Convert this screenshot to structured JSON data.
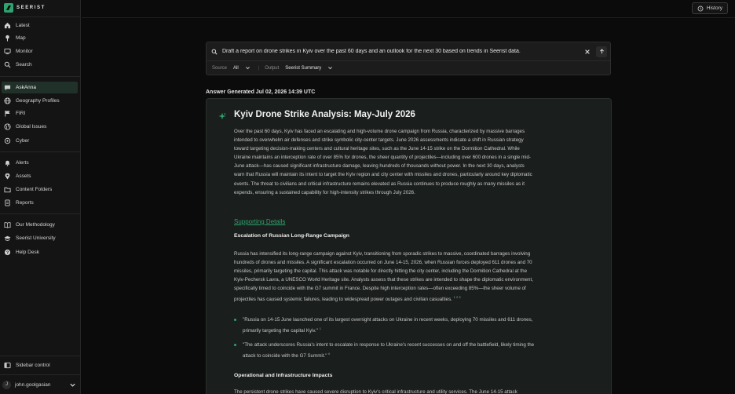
{
  "app": {
    "logo_text": "SEERIST",
    "brand_color": "#2ea36f"
  },
  "sidebar": {
    "items_top": [
      {
        "label": "Latest",
        "icon": "home-icon"
      },
      {
        "label": "Map",
        "icon": "map-pin-icon"
      },
      {
        "label": "Monitor",
        "icon": "monitor-icon"
      },
      {
        "label": "Search",
        "icon": "search-icon"
      }
    ],
    "items_mid": [
      {
        "label": "AskAnna",
        "icon": "chat-icon",
        "active": true
      },
      {
        "label": "Geography Profiles",
        "icon": "globe-icon"
      },
      {
        "label": "FIRI",
        "icon": "flag-icon"
      },
      {
        "label": "Global Issues",
        "icon": "globe-issues-icon"
      },
      {
        "label": "Cyber",
        "icon": "cyber-icon"
      }
    ],
    "items_low": [
      {
        "label": "Alerts",
        "icon": "bell-icon"
      },
      {
        "label": "Assets",
        "icon": "pin-icon"
      },
      {
        "label": "Content Folders",
        "icon": "folder-icon"
      },
      {
        "label": "Reports",
        "icon": "reports-icon"
      }
    ],
    "items_help": [
      {
        "label": "Our Methodology",
        "icon": "book-icon"
      },
      {
        "label": "Seerist University",
        "icon": "graduation-icon"
      },
      {
        "label": "Help Desk",
        "icon": "help-icon"
      }
    ],
    "control_label": "Sidebar control",
    "user": {
      "initial": "J",
      "name": "john.goolgasian"
    }
  },
  "topbar": {
    "history_label": "History"
  },
  "query": {
    "text": "Draft a report on drone strikes in Kyiv over the past 60 days and an outlook for the next 30 based on trends in Seerist data.",
    "source_label": "Source",
    "source_value": "All",
    "output_label": "Output",
    "output_value": "Seerist Summary"
  },
  "answer": {
    "generated": "Answer Generated Jul 02, 2026 14:39 UTC",
    "title": "Kyiv Drone Strike Analysis: May-July 2026",
    "summary": [
      "Over the past 60 days, Kyiv has faced an escalating and high-volume drone campaign from Russia, characterized by massive barrages",
      "intended to overwhelm air defenses and strike symbolic city-center targets. June 2026 assessments indicate a shift in Russian strategy",
      "toward targeting decision-making centers and cultural heritage sites, such as the June 14-15 strike on the Dormition Cathedral. While",
      "Ukraine maintains an interception rate of over 85% for drones, the sheer quantity of projectiles—including over 600 drones in a single mid-",
      "June attack—has caused significant infrastructure damage, leaving hundreds of thousands without power. In the next 30 days, analysts",
      "warn that Russia will maintain its intent to target the Kyiv region and city center with missiles and drones, particularly around key diplomatic",
      "events. The threat to civilians and critical infrastructure remains elevated as Russia continues to produce roughly as many missiles as it",
      "expends, ensuring a sustained capability for high-intensity strikes through July 2026."
    ],
    "supporting_label": "Supporting Details",
    "section1_title": "Escalation of Russian Long-Range Campaign",
    "section1": [
      "Russia has intensified its long-range campaign against Kyiv, transitioning from sporadic strikes to massive, coordinated barrages involving",
      "hundreds of drones and missiles. A significant escalation occurred on June 14-15, 2026, when Russian forces deployed 611 drones and 70",
      "missiles, primarily targeting the capital. This attack was notable for directly hitting the city center, including the Dormition Cathedral at the",
      "Kyiv-Pechersk Lavra, a UNESCO World Heritage site. Analysts assess that these strikes are intended to shape the diplomatic environment,",
      "specifically timed to coincide with the G7 summit in France. Despite high interception rates—often exceeding 85%—the sheer volume of",
      "projectiles has caused systemic failures, leading to widespread power outages and civilian casualties."
    ],
    "section1_refs": "1 2 3",
    "bullets": [
      {
        "lines": [
          "\"Russia on 14-15 June launched one of its largest overnight attacks on Ukraine in recent weeks, deploying 70 missiles and 611 drones,",
          "primarily targeting the capital Kyiv.\""
        ],
        "ref": "1"
      },
      {
        "lines": [
          "\"The attack underscores Russia's intent to escalate in response to Ukraine's recent successes on and off the battlefield, likely timing the",
          "attack to coincide with the G7 Summit.\""
        ],
        "ref": "6"
      }
    ],
    "section2_title": "Operational and Infrastructure Impacts",
    "section2_first": "The persistent drone strikes have caused severe disruption to Kyiv's critical infrastructure and utility services. The June 14-15 attack"
  }
}
